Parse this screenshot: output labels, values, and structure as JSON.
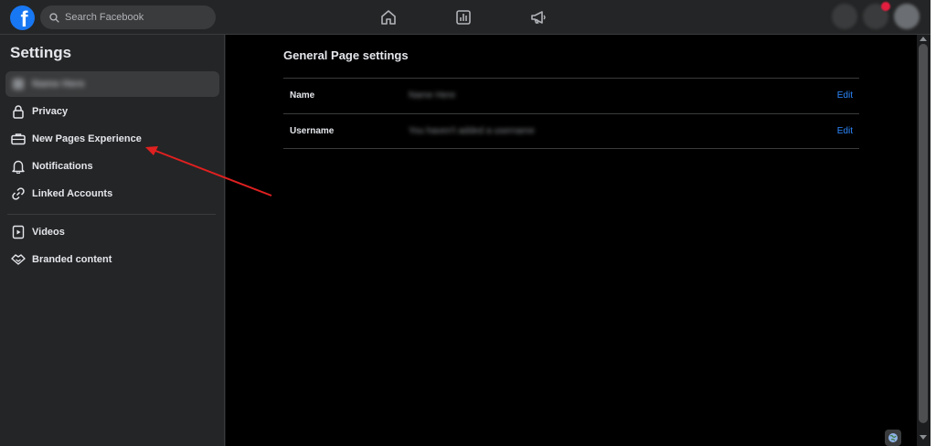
{
  "topbar": {
    "logo_letter": "f",
    "search_placeholder": "Search Facebook",
    "nav_icons": [
      "home-icon",
      "insights-icon",
      "megaphone-icon"
    ]
  },
  "sidebar": {
    "title": "Settings",
    "page_name": "Name Here",
    "items": [
      {
        "label": "Privacy",
        "icon": "lock-icon"
      },
      {
        "label": "New Pages Experience",
        "icon": "briefcase-icon"
      },
      {
        "label": "Notifications",
        "icon": "bell-icon"
      },
      {
        "label": "Linked Accounts",
        "icon": "link-icon"
      },
      {
        "label": "Videos",
        "icon": "video-icon"
      },
      {
        "label": "Branded content",
        "icon": "handshake-icon"
      }
    ]
  },
  "main": {
    "title": "General Page settings",
    "rows": [
      {
        "label": "Name",
        "value": "Name Here",
        "action": "Edit"
      },
      {
        "label": "Username",
        "value": "You haven't added a username",
        "action": "Edit"
      }
    ]
  },
  "colors": {
    "accent": "#1877f2",
    "link": "#2d88ff",
    "annotation_arrow": "#e02020"
  }
}
